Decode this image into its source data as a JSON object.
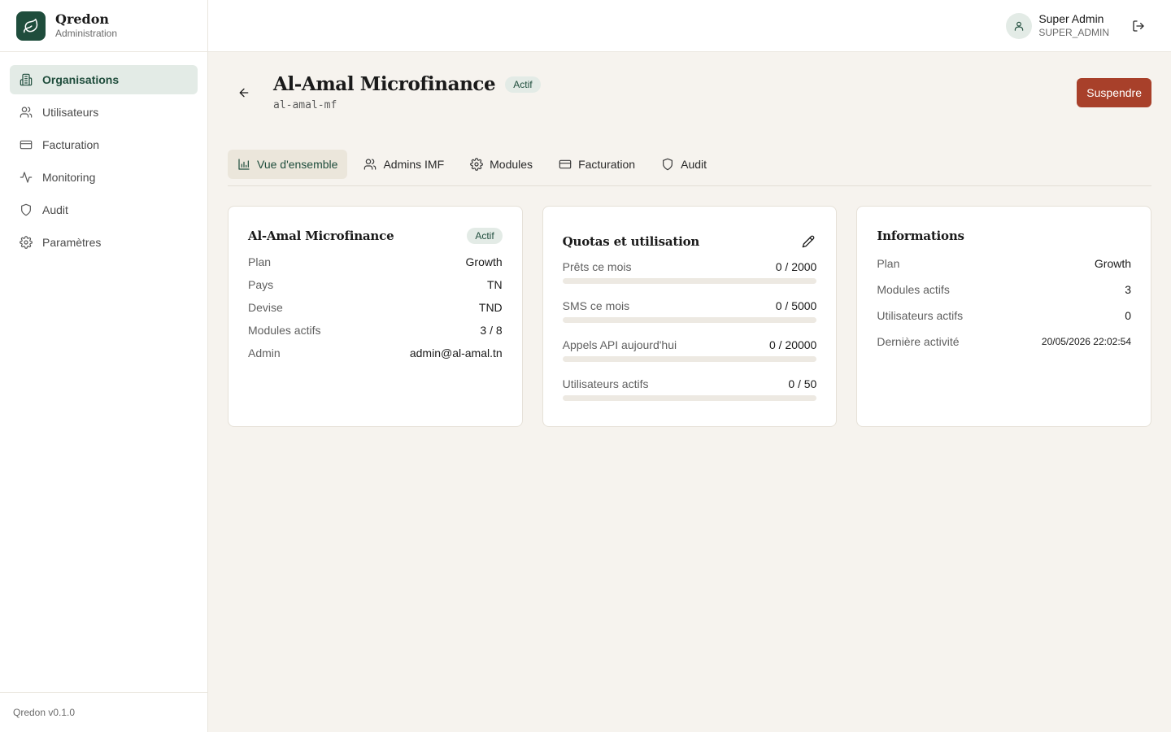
{
  "brand": {
    "name": "Qredon",
    "subtitle": "Administration"
  },
  "sidebar": {
    "items": [
      {
        "label": "Organisations",
        "icon": "building-icon",
        "active": true
      },
      {
        "label": "Utilisateurs",
        "icon": "users-icon"
      },
      {
        "label": "Facturation",
        "icon": "credit-card-icon"
      },
      {
        "label": "Monitoring",
        "icon": "activity-icon"
      },
      {
        "label": "Audit",
        "icon": "shield-icon"
      },
      {
        "label": "Paramètres",
        "icon": "gear-icon"
      }
    ],
    "version": "Qredon v0.1.0"
  },
  "user": {
    "name": "Super Admin",
    "role": "SUPER_ADMIN"
  },
  "org": {
    "name": "Al-Amal Microfinance",
    "status": "Actif",
    "slug": "al-amal-mf",
    "suspend_label": "Suspendre"
  },
  "tabs": [
    {
      "label": "Vue d'ensemble",
      "icon": "bar-chart-icon",
      "active": true
    },
    {
      "label": "Admins IMF",
      "icon": "users-icon"
    },
    {
      "label": "Modules",
      "icon": "gear-icon"
    },
    {
      "label": "Facturation",
      "icon": "credit-card-icon"
    },
    {
      "label": "Audit",
      "icon": "shield-icon"
    }
  ],
  "overview_card": {
    "title": "Al-Amal Microfinance",
    "status": "Actif",
    "rows": [
      {
        "label": "Plan",
        "value": "Growth"
      },
      {
        "label": "Pays",
        "value": "TN"
      },
      {
        "label": "Devise",
        "value": "TND"
      },
      {
        "label": "Modules actifs",
        "value": "3 / 8"
      },
      {
        "label": "Admin",
        "value": "admin@al-amal.tn"
      }
    ]
  },
  "quota_card": {
    "title": "Quotas et utilisation",
    "items": [
      {
        "label": "Prêts ce mois",
        "value": "0 / 2000",
        "fraction": 0
      },
      {
        "label": "SMS ce mois",
        "value": "0 / 5000",
        "fraction": 0
      },
      {
        "label": "Appels API aujourd'hui",
        "value": "0 / 20000",
        "fraction": 0
      },
      {
        "label": "Utilisateurs actifs",
        "value": "0 / 50",
        "fraction": 0
      }
    ]
  },
  "info_card": {
    "title": "Informations",
    "rows": [
      {
        "label": "Plan",
        "value": "Growth"
      },
      {
        "label": "Modules actifs",
        "value": "3"
      },
      {
        "label": "Utilisateurs actifs",
        "value": "0"
      },
      {
        "label": "Dernière activité",
        "value": "20/05/2026 22:02:54"
      }
    ]
  },
  "colors": {
    "brand": "#1f4d3c",
    "danger": "#a8402a",
    "background": "#f6f3ee"
  }
}
